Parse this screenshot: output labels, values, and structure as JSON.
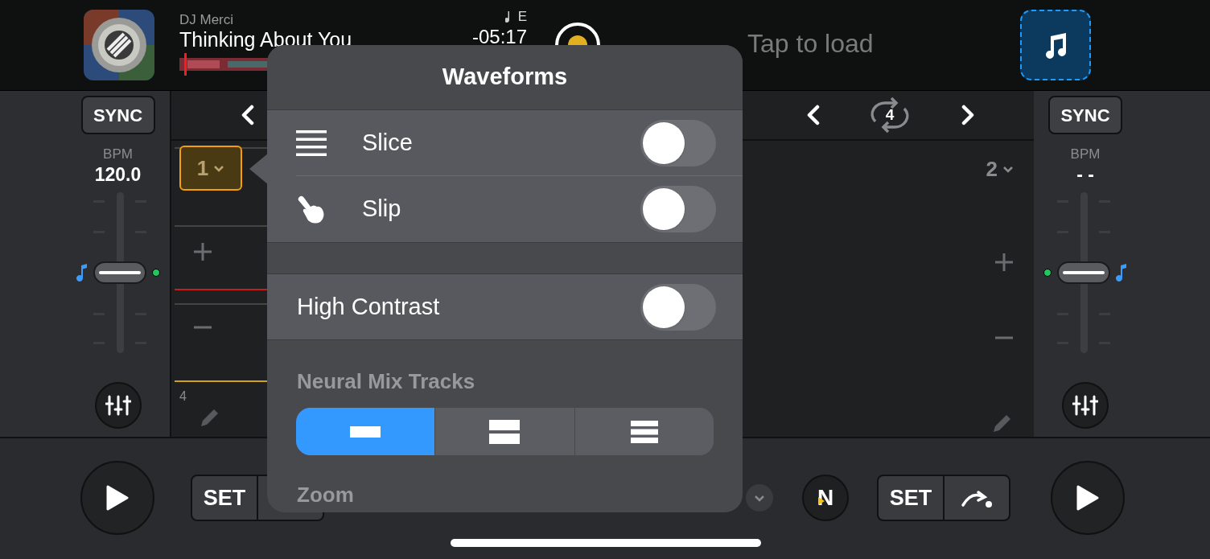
{
  "left_deck": {
    "artist": "DJ Merci",
    "title": "Thinking About You",
    "key": "E",
    "time": "-05:17",
    "sync": "SYNC",
    "bpm_label": "BPM",
    "bpm": "120.0",
    "pitch": {
      "level": 0.5
    },
    "cue_pad": "1",
    "beat_marker": "4"
  },
  "right_deck": {
    "placeholder": "Tap to load",
    "sync": "SYNC",
    "bpm_label": "BPM",
    "bpm": "- -",
    "pitch": {
      "level": 0.5
    },
    "cue_pad": "2",
    "loop_size": "4"
  },
  "popover": {
    "title": "Waveforms",
    "toggles": [
      {
        "label": "Slice",
        "on": false
      },
      {
        "label": "Slip",
        "on": false
      }
    ],
    "high_contrast": {
      "label": "High Contrast",
      "on": false
    },
    "neural_mix": {
      "label": "Neural Mix Tracks",
      "segments": [
        {
          "selected": true
        },
        {
          "selected": false
        },
        {
          "selected": false
        }
      ]
    },
    "zoom_label": "Zoom"
  },
  "transport": {
    "left_set": "SET",
    "neural_mix_button": "N",
    "right_set": "SET"
  }
}
